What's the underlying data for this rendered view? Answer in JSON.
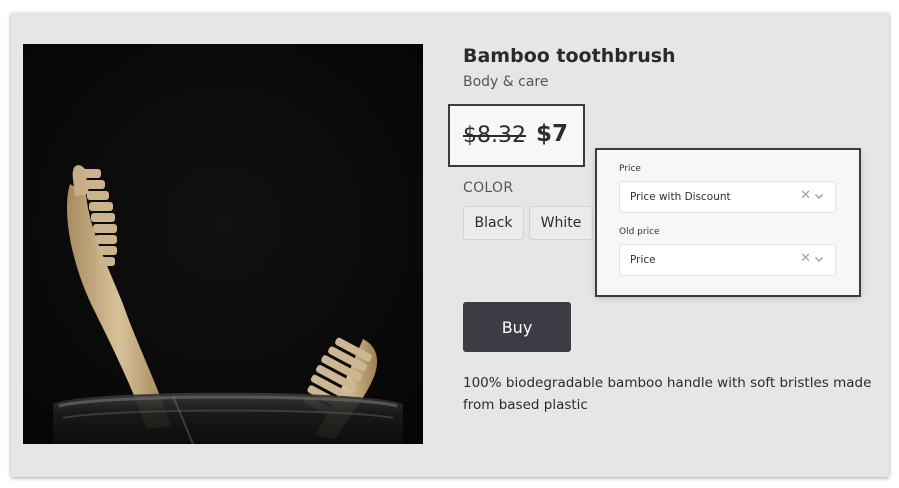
{
  "product": {
    "title": "Bamboo toothbrush",
    "category": "Body & care",
    "old_price": "$8.32",
    "new_price": "$7",
    "color_label": "COLOR",
    "colors": [
      "Black",
      "White"
    ],
    "buy_label": "Buy",
    "description": "100% biodegradable bamboo handle with soft bristles made from based plastic"
  },
  "settings_popup": {
    "price_label": "Price",
    "price_value": "Price with Discount",
    "old_price_label": "Old price",
    "old_price_value": "Price"
  },
  "colors": {
    "page_background": "#e6e6e6",
    "buy_button": "#3b3c44",
    "highlight_border": "#3a3b40"
  }
}
